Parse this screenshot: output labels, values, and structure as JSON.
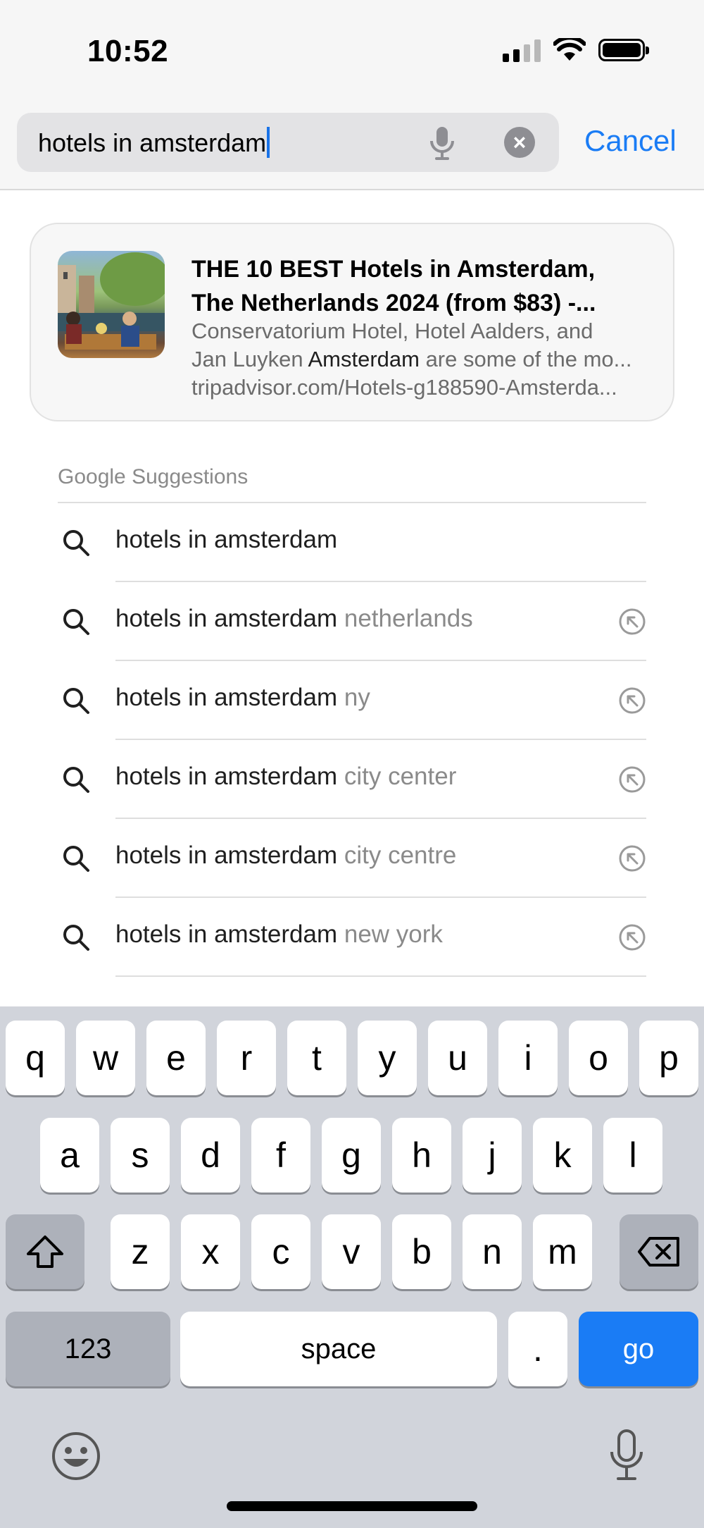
{
  "status_bar": {
    "time": "10:52",
    "icons": [
      "cellular-signal-icon",
      "wifi-icon",
      "battery-icon"
    ]
  },
  "search": {
    "value": "hotels in amsterdam",
    "cancel_label": "Cancel",
    "icons": [
      "microphone-icon",
      "clear-icon"
    ],
    "accent_color": "#1a7cf5"
  },
  "top_result": {
    "title_line1": "THE 10 BEST Hotels in Amsterdam,",
    "title_line2": "The Netherlands 2024 (from $83) -...",
    "snippet_line1": "Conservatorium Hotel, Hotel Aalders, and",
    "snippet_line2_pre": "Jan Luyken ",
    "snippet_line2_highlight": "Amsterdam",
    "snippet_line2_post": " are some of the mo...",
    "url": "tripadvisor.com/Hotels-g188590-Amsterda..."
  },
  "suggestions": {
    "header": "Google Suggestions",
    "items": [
      {
        "base": "hotels in amsterdam",
        "rest": "",
        "fill_arrow": false
      },
      {
        "base": "hotels in amsterdam",
        "rest": " netherlands",
        "fill_arrow": true
      },
      {
        "base": "hotels in amsterdam",
        "rest": " ny",
        "fill_arrow": true
      },
      {
        "base": "hotels in amsterdam",
        "rest": " city center",
        "fill_arrow": true
      },
      {
        "base": "hotels in amsterdam",
        "rest": " city centre",
        "fill_arrow": true
      },
      {
        "base": "hotels in amsterdam",
        "rest": " new york",
        "fill_arrow": true
      }
    ]
  },
  "keyboard": {
    "row1": [
      "q",
      "w",
      "e",
      "r",
      "t",
      "y",
      "u",
      "i",
      "o",
      "p"
    ],
    "row2": [
      "a",
      "s",
      "d",
      "f",
      "g",
      "h",
      "j",
      "k",
      "l"
    ],
    "row3": [
      "z",
      "x",
      "c",
      "v",
      "b",
      "n",
      "m"
    ],
    "numbers_label": "123",
    "space_label": "space",
    "period_label": ".",
    "go_label": "go",
    "icons": [
      "shift-icon",
      "backspace-icon",
      "emoji-icon",
      "dictation-icon"
    ]
  }
}
